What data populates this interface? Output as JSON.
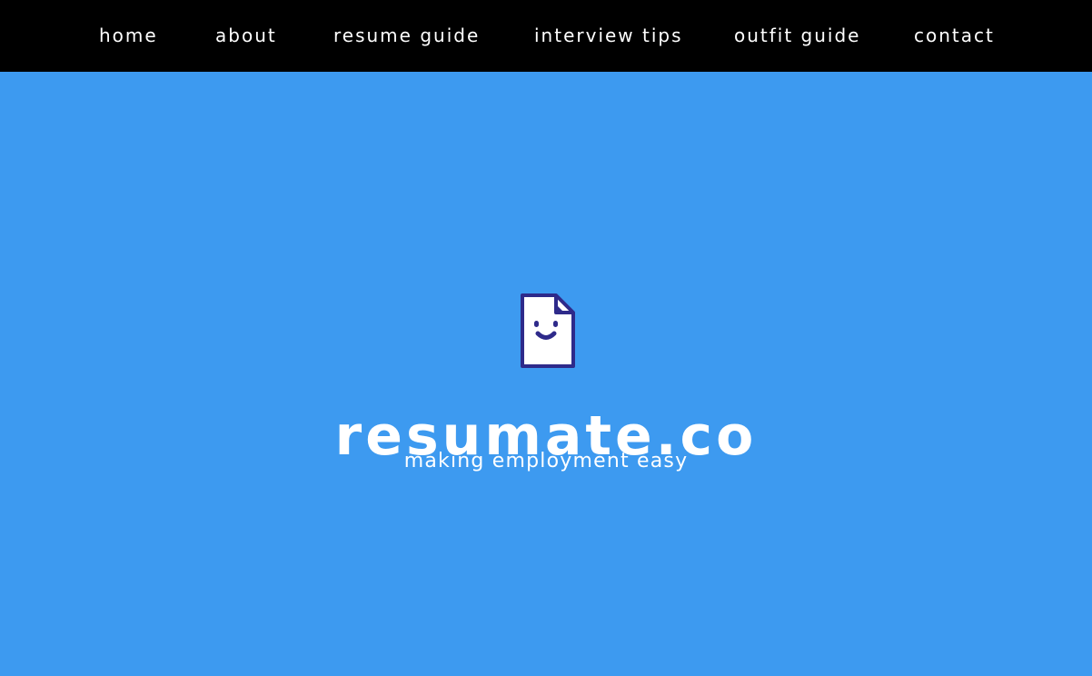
{
  "nav": {
    "items": [
      {
        "label": "home"
      },
      {
        "label": "about"
      },
      {
        "label": "resume guide"
      },
      {
        "label": "interview tips"
      },
      {
        "label": "outfit guide"
      },
      {
        "label": "contact"
      }
    ]
  },
  "hero": {
    "logo_icon": "smiling-document-icon",
    "brand": "resumate.co",
    "tagline": "making employment easy"
  },
  "colors": {
    "nav_background": "#000000",
    "hero_background": "#3d9af0",
    "logo_icon": "#2e2a8a",
    "text": "#ffffff"
  }
}
